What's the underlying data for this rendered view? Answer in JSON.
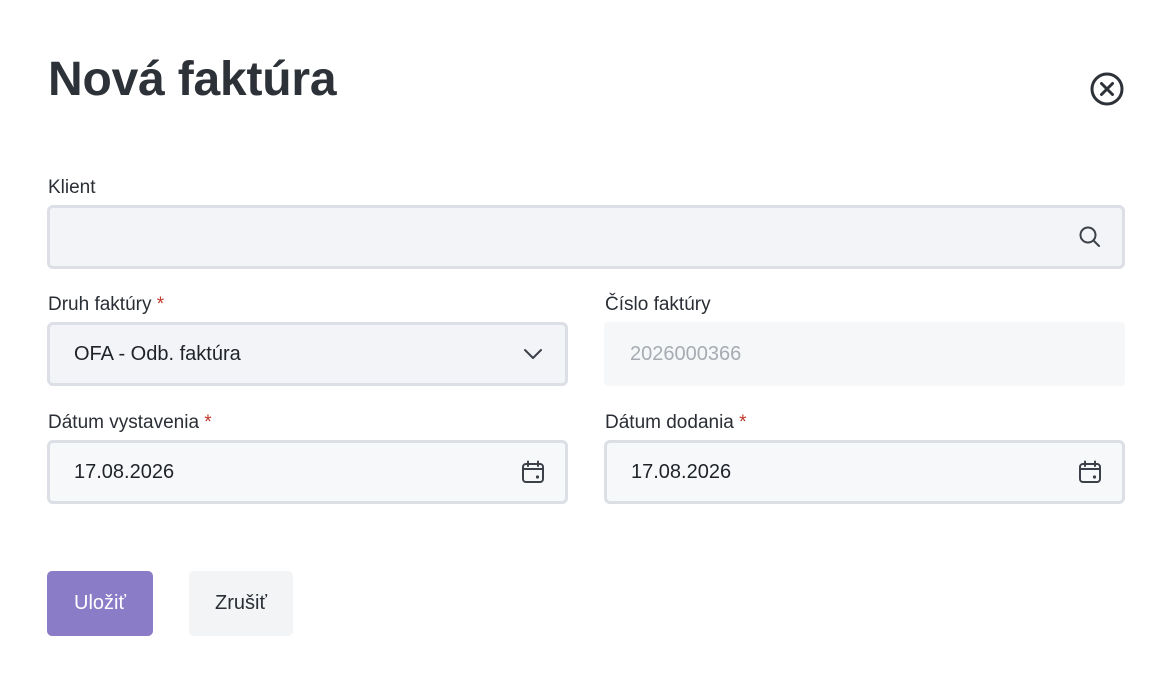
{
  "dialog": {
    "title": "Nová faktúra",
    "close_icon": "close-circle-icon"
  },
  "form": {
    "client": {
      "label": "Klient",
      "value": "",
      "icon": "search-icon"
    },
    "invoice_type": {
      "label": "Druh faktúry",
      "required_mark": "*",
      "value": "OFA - Odb. faktúra",
      "icon": "chevron-down-icon"
    },
    "invoice_number": {
      "label": "Číslo faktúry",
      "value": "2026000366"
    },
    "issue_date": {
      "label": "Dátum vystavenia",
      "required_mark": "*",
      "value": "17.08.2026",
      "icon": "calendar-icon"
    },
    "delivery_date": {
      "label": "Dátum dodania",
      "required_mark": "*",
      "value": "17.08.2026",
      "icon": "calendar-icon"
    }
  },
  "actions": {
    "save_label": "Uložiť",
    "cancel_label": "Zrušiť"
  },
  "colors": {
    "primary": "#8b7cc8",
    "required": "#c0392b",
    "field_border": "#dcdfe5",
    "field_bg": "#f3f4f7"
  }
}
